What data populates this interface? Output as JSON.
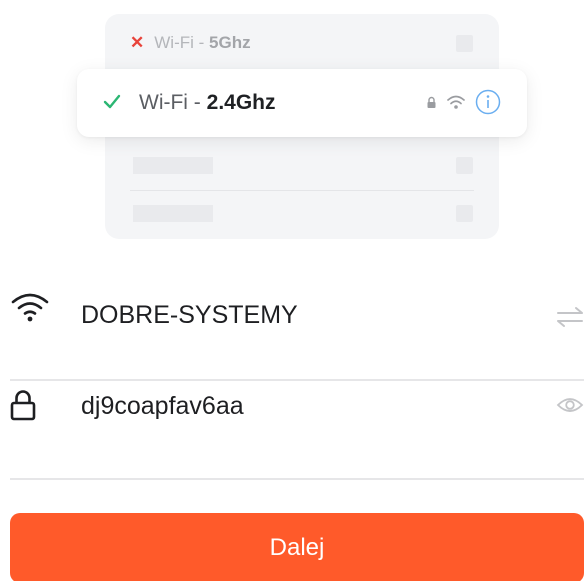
{
  "illustration": {
    "wrong_network": {
      "prefix": "Wi-Fi - ",
      "band": "5Ghz",
      "status_icon": "x-icon",
      "status_color": "#e8433a"
    },
    "right_network": {
      "prefix": "Wi-Fi - ",
      "band": "2.4Ghz",
      "status_icon": "check-icon",
      "status_color": "#2bb673",
      "icons": [
        "lock-icon",
        "wifi-icon",
        "info-icon"
      ]
    }
  },
  "form": {
    "wifi": {
      "icon": "wifi-icon",
      "ssid": "DOBRE-SYSTEMY",
      "action_icon": "swap-icon"
    },
    "password": {
      "icon": "lock-icon",
      "value": "dj9coapfav6aa",
      "action_icon": "eye-icon"
    }
  },
  "next_button": {
    "label": "Dalej",
    "color": "#ff5a2a"
  }
}
